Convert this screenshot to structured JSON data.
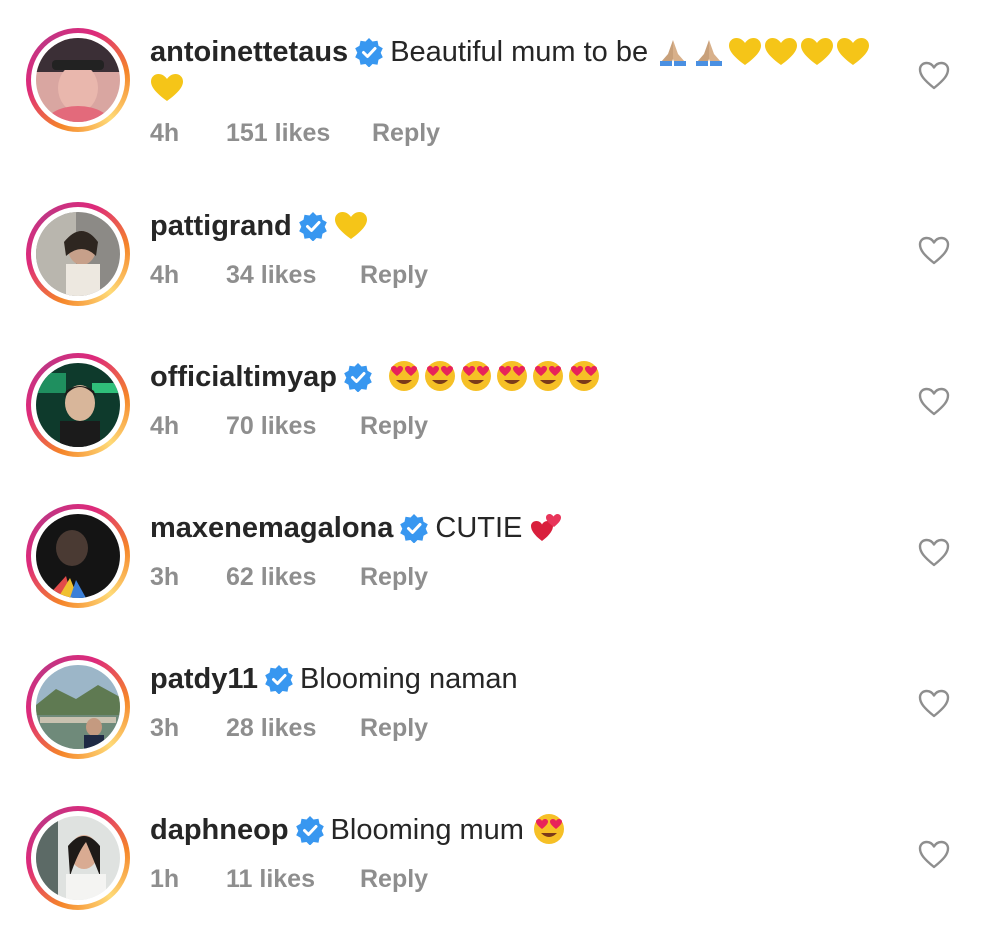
{
  "comments": [
    {
      "username": "antoinettetaus",
      "verified": true,
      "text": "Beautiful mum to be",
      "emojis": [
        "folded-hands",
        "folded-hands",
        "yellow-heart",
        "yellow-heart",
        "yellow-heart",
        "yellow-heart",
        "yellow-heart"
      ],
      "time": "4h",
      "likes": "151 likes",
      "reply": "Reply"
    },
    {
      "username": "pattigrand",
      "verified": true,
      "text": "",
      "emojis": [
        "yellow-heart"
      ],
      "time": "4h",
      "likes": "34 likes",
      "reply": "Reply"
    },
    {
      "username": "officialtimyap",
      "verified": true,
      "text": "",
      "emojis": [
        "heart-eyes",
        "heart-eyes",
        "heart-eyes",
        "heart-eyes",
        "heart-eyes",
        "heart-eyes"
      ],
      "time": "4h",
      "likes": "70 likes",
      "reply": "Reply"
    },
    {
      "username": "maxenemagalona",
      "verified": true,
      "text": "CUTIE",
      "emojis": [
        "two-hearts"
      ],
      "time": "3h",
      "likes": "62 likes",
      "reply": "Reply"
    },
    {
      "username": "patdy11",
      "verified": true,
      "text": "Blooming naman",
      "emojis": [],
      "time": "3h",
      "likes": "28 likes",
      "reply": "Reply"
    },
    {
      "username": "daphneop",
      "verified": true,
      "text": "Blooming mum",
      "emojis": [
        "heart-eyes"
      ],
      "time": "1h",
      "likes": "11 likes",
      "reply": "Reply"
    }
  ],
  "icons": {
    "verified": "verified-badge-icon",
    "like": "heart-outline-icon"
  },
  "colors": {
    "username": "#262626",
    "meta": "#8e8e8e",
    "verified": "#3897f0",
    "ring_start": "#f58529",
    "ring_end": "#dd2a7b"
  }
}
